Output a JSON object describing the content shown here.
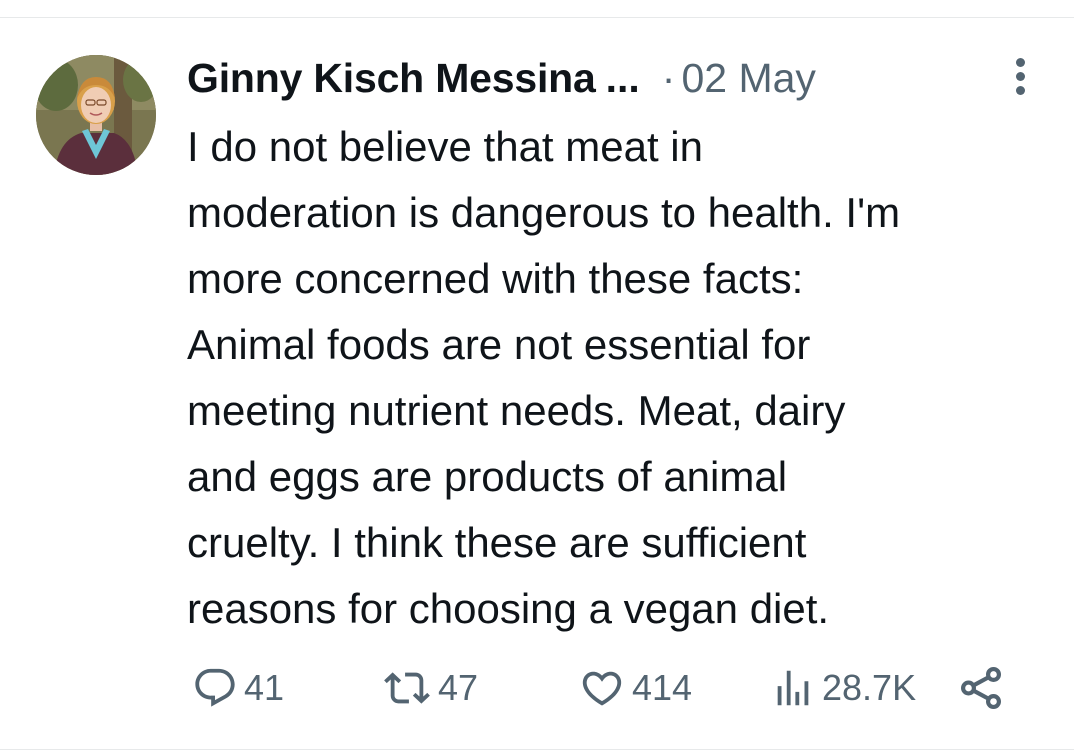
{
  "post": {
    "author_name": "Ginny Kisch Messina",
    "truncation": "...",
    "separator": "·",
    "date": "02 May",
    "text_lines": [
      "I do not believe that meat in",
      "moderation is dangerous to health. I'm",
      "more concerned with these facts:",
      "Animal foods are not essential for",
      "meeting nutrient needs. Meat, dairy",
      "and eggs are products of animal",
      "cruelty. I think these are sufficient",
      "reasons for choosing a vegan diet."
    ]
  },
  "actions": {
    "replies": "41",
    "reposts": "47",
    "likes": "414",
    "views": "28.7K"
  },
  "icons": {
    "reply": "reply-icon",
    "repost": "repost-icon",
    "like": "like-icon",
    "views": "views-icon",
    "share": "share-icon",
    "more": "more-options-icon"
  },
  "colors": {
    "text": "#0f1419",
    "secondary": "#536471",
    "divider": "#e7e9ea"
  }
}
